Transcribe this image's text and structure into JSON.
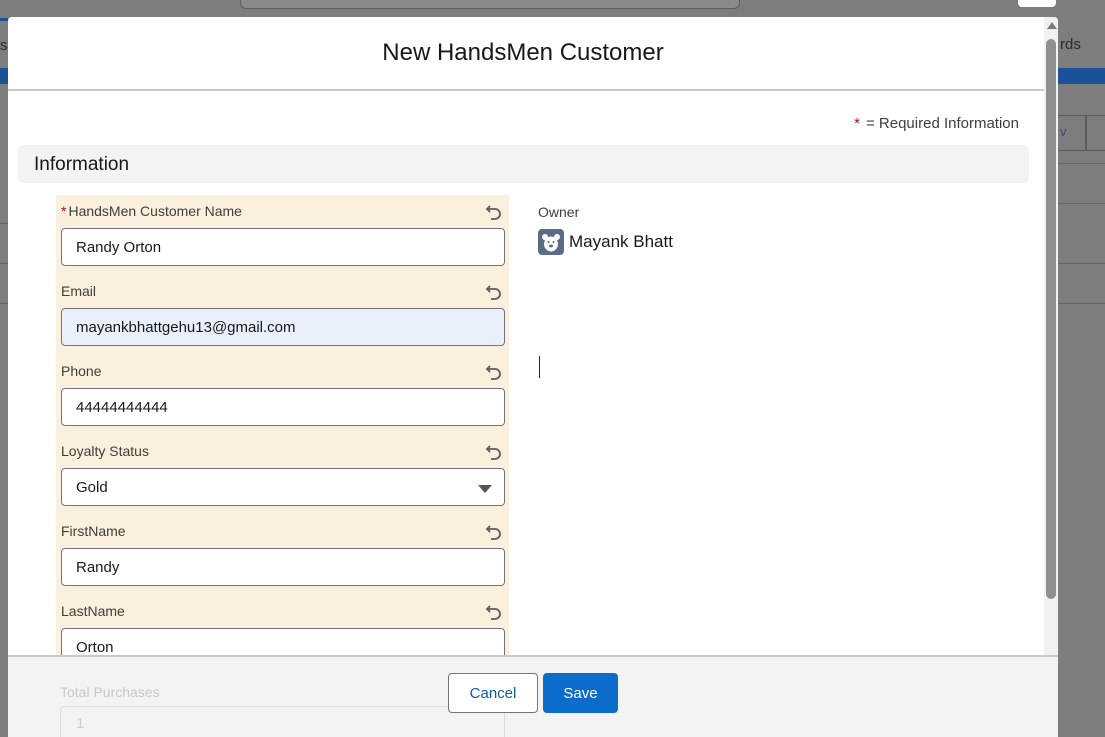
{
  "background": {
    "left_text": "st",
    "right_text": "rds",
    "right_link": "v"
  },
  "modal": {
    "title": "New HandsMen Customer",
    "required_note_star": "*",
    "required_note": "= Required Information",
    "section_title": "Information"
  },
  "fields": {
    "customer_name": {
      "required_star": "*",
      "label": "HandsMen Customer Name",
      "value": "Randy Orton"
    },
    "email": {
      "label": "Email",
      "value": "mayankbhattgehu13@gmail.com"
    },
    "phone": {
      "label": "Phone",
      "value": "44444444444"
    },
    "loyalty_status": {
      "label": "Loyalty Status",
      "value": "Gold"
    },
    "first_name": {
      "label": "FirstName",
      "value": "Randy"
    },
    "last_name": {
      "label": "LastName",
      "value": "Orton"
    },
    "total_purchases": {
      "label": "Total Purchases",
      "value": "1"
    }
  },
  "owner": {
    "label": "Owner",
    "name": "Mayank Bhatt"
  },
  "footer": {
    "cancel_label": "Cancel",
    "save_label": "Save"
  },
  "icons": {
    "undo": "undo-icon",
    "dropdown": "chevron-down-icon",
    "avatar": "user-avatar-icon"
  },
  "colors": {
    "required": "#ba0517",
    "save_button": "#0b6ccb",
    "cancel_text": "#0b5cab",
    "field_highlight": "#faf0dd",
    "focused_input": "#e9effb"
  }
}
